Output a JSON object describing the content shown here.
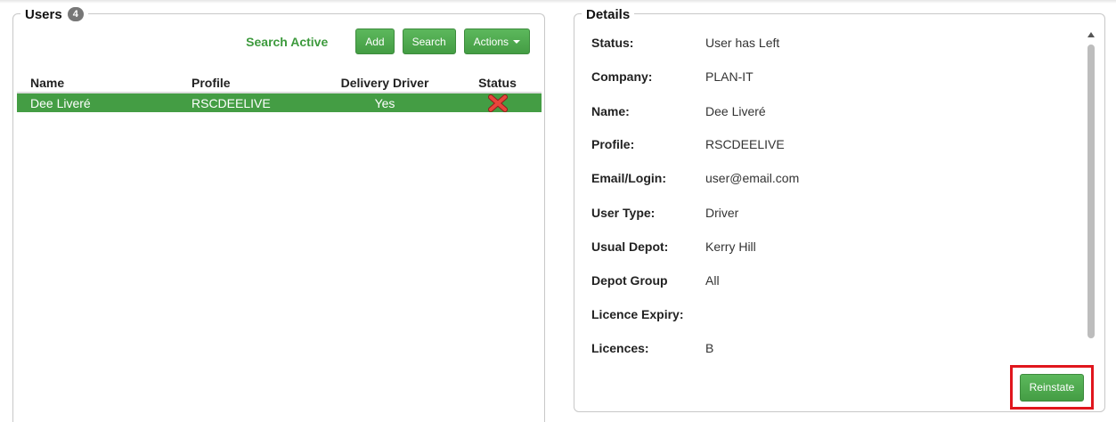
{
  "users_panel": {
    "title": "Users",
    "count": "4",
    "search_active": "Search Active",
    "add_label": "Add",
    "search_label": "Search",
    "actions_label": "Actions",
    "columns": {
      "name": "Name",
      "profile": "Profile",
      "delivery_driver": "Delivery Driver",
      "status": "Status"
    },
    "rows": [
      {
        "name": "Dee Liveré",
        "profile": "RSCDEELIVE",
        "delivery_driver": "Yes",
        "status_icon": "red-x-icon"
      }
    ]
  },
  "details_panel": {
    "title": "Details",
    "fields": [
      {
        "label": "Status:",
        "value": "User has Left"
      },
      {
        "label": "Company:",
        "value": "PLAN-IT"
      },
      {
        "label": "Name:",
        "value": "Dee Liveré"
      },
      {
        "label": "Profile:",
        "value": "RSCDEELIVE"
      },
      {
        "label": "Email/Login:",
        "value": "user@email.com"
      },
      {
        "label": "User Type:",
        "value": "Driver"
      },
      {
        "label": "Usual Depot:",
        "value": "Kerry Hill"
      },
      {
        "label": "Depot Group",
        "value": "All"
      },
      {
        "label": "Licence Expiry:",
        "value": ""
      },
      {
        "label": "Licences:",
        "value": "B"
      }
    ],
    "reinstate_label": "Reinstate"
  },
  "colors": {
    "accent_green": "#449d44",
    "highlight_red": "#e0161d",
    "badge_grey": "#777777"
  }
}
